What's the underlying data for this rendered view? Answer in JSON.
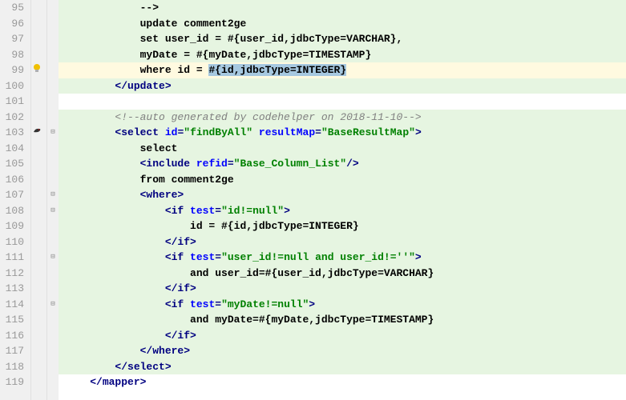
{
  "lines": [
    {
      "n": "95",
      "bg": "added",
      "indent": 12,
      "tokens": [
        {
          "t": "text",
          "v": "-->"
        }
      ]
    },
    {
      "n": "96",
      "bg": "added",
      "indent": 12,
      "tokens": [
        {
          "t": "text",
          "v": "update comment2ge"
        }
      ]
    },
    {
      "n": "97",
      "bg": "added",
      "indent": 12,
      "tokens": [
        {
          "t": "text",
          "v": "set user_id = #{user_id,jdbcType=VARCHAR},"
        }
      ]
    },
    {
      "n": "98",
      "bg": "added",
      "indent": 12,
      "tokens": [
        {
          "t": "text",
          "v": "myDate = #{myDate,jdbcType=TIMESTAMP}"
        }
      ]
    },
    {
      "n": "99",
      "bg": "highlight",
      "indent": 12,
      "icon": "bulb",
      "tokens": [
        {
          "t": "text",
          "v": "where id = "
        },
        {
          "t": "sel",
          "v": "#{id,jdbcType=INTEGER}"
        }
      ]
    },
    {
      "n": "100",
      "bg": "added",
      "indent": 8,
      "tokens": [
        {
          "t": "tag",
          "v": "</update>"
        }
      ]
    },
    {
      "n": "101",
      "bg": "",
      "indent": 0,
      "tokens": []
    },
    {
      "n": "102",
      "bg": "added",
      "indent": 8,
      "tokens": [
        {
          "t": "comment",
          "v": "<!--auto generated by codehelper on 2018-11-10-->"
        }
      ]
    },
    {
      "n": "103",
      "bg": "added",
      "indent": 8,
      "icon": "bird",
      "fold": "-",
      "tokens": [
        {
          "t": "tag",
          "v": "<select "
        },
        {
          "t": "attr-name",
          "v": "id"
        },
        {
          "t": "tag",
          "v": "="
        },
        {
          "t": "attr-val",
          "v": "\"findByAll\""
        },
        {
          "t": "tag",
          "v": " "
        },
        {
          "t": "attr-name",
          "v": "resultMap"
        },
        {
          "t": "tag",
          "v": "="
        },
        {
          "t": "attr-val",
          "v": "\"BaseResultMap\""
        },
        {
          "t": "tag",
          "v": ">"
        }
      ]
    },
    {
      "n": "104",
      "bg": "added",
      "indent": 12,
      "tokens": [
        {
          "t": "text",
          "v": "select"
        }
      ]
    },
    {
      "n": "105",
      "bg": "added",
      "indent": 12,
      "tokens": [
        {
          "t": "tag",
          "v": "<include "
        },
        {
          "t": "attr-name",
          "v": "refid"
        },
        {
          "t": "tag",
          "v": "="
        },
        {
          "t": "attr-val",
          "v": "\"Base_Column_List\""
        },
        {
          "t": "tag",
          "v": "/>"
        }
      ]
    },
    {
      "n": "106",
      "bg": "added",
      "indent": 12,
      "tokens": [
        {
          "t": "text",
          "v": "from comment2ge"
        }
      ]
    },
    {
      "n": "107",
      "bg": "added",
      "indent": 12,
      "fold": "-",
      "tokens": [
        {
          "t": "tag",
          "v": "<where>"
        }
      ]
    },
    {
      "n": "108",
      "bg": "added",
      "indent": 16,
      "fold": "-",
      "tokens": [
        {
          "t": "tag",
          "v": "<if "
        },
        {
          "t": "attr-name",
          "v": "test"
        },
        {
          "t": "tag",
          "v": "="
        },
        {
          "t": "attr-val",
          "v": "\"id!=null\""
        },
        {
          "t": "tag",
          "v": ">"
        }
      ]
    },
    {
      "n": "109",
      "bg": "added",
      "indent": 20,
      "tokens": [
        {
          "t": "text",
          "v": "id = #{id,jdbcType=INTEGER}"
        }
      ]
    },
    {
      "n": "110",
      "bg": "added",
      "indent": 16,
      "tokens": [
        {
          "t": "tag",
          "v": "</if>"
        }
      ]
    },
    {
      "n": "111",
      "bg": "added",
      "indent": 16,
      "fold": "-",
      "tokens": [
        {
          "t": "tag",
          "v": "<if "
        },
        {
          "t": "attr-name",
          "v": "test"
        },
        {
          "t": "tag",
          "v": "="
        },
        {
          "t": "attr-val",
          "v": "\"user_id!=null and user_id!=''\""
        },
        {
          "t": "tag",
          "v": ">"
        }
      ]
    },
    {
      "n": "112",
      "bg": "added",
      "indent": 20,
      "tokens": [
        {
          "t": "text",
          "v": "and user_id=#{user_id,jdbcType=VARCHAR}"
        }
      ]
    },
    {
      "n": "113",
      "bg": "added",
      "indent": 16,
      "tokens": [
        {
          "t": "tag",
          "v": "</if>"
        }
      ]
    },
    {
      "n": "114",
      "bg": "added",
      "indent": 16,
      "fold": "-",
      "tokens": [
        {
          "t": "tag",
          "v": "<if "
        },
        {
          "t": "attr-name",
          "v": "test"
        },
        {
          "t": "tag",
          "v": "="
        },
        {
          "t": "attr-val",
          "v": "\"myDate!=null\""
        },
        {
          "t": "tag",
          "v": ">"
        }
      ]
    },
    {
      "n": "115",
      "bg": "added",
      "indent": 20,
      "tokens": [
        {
          "t": "text",
          "v": "and myDate=#{myDate,jdbcType=TIMESTAMP}"
        }
      ]
    },
    {
      "n": "116",
      "bg": "added",
      "indent": 16,
      "tokens": [
        {
          "t": "tag",
          "v": "</if>"
        }
      ]
    },
    {
      "n": "117",
      "bg": "added",
      "indent": 12,
      "tokens": [
        {
          "t": "tag",
          "v": "</where>"
        }
      ]
    },
    {
      "n": "118",
      "bg": "added",
      "indent": 8,
      "tokens": [
        {
          "t": "tag",
          "v": "</select>"
        }
      ]
    },
    {
      "n": "119",
      "bg": "",
      "indent": 4,
      "tokens": [
        {
          "t": "tag",
          "v": "</mapper>"
        }
      ]
    }
  ],
  "icons": {
    "bulb": "bulb-icon",
    "bird": "bird-icon"
  }
}
